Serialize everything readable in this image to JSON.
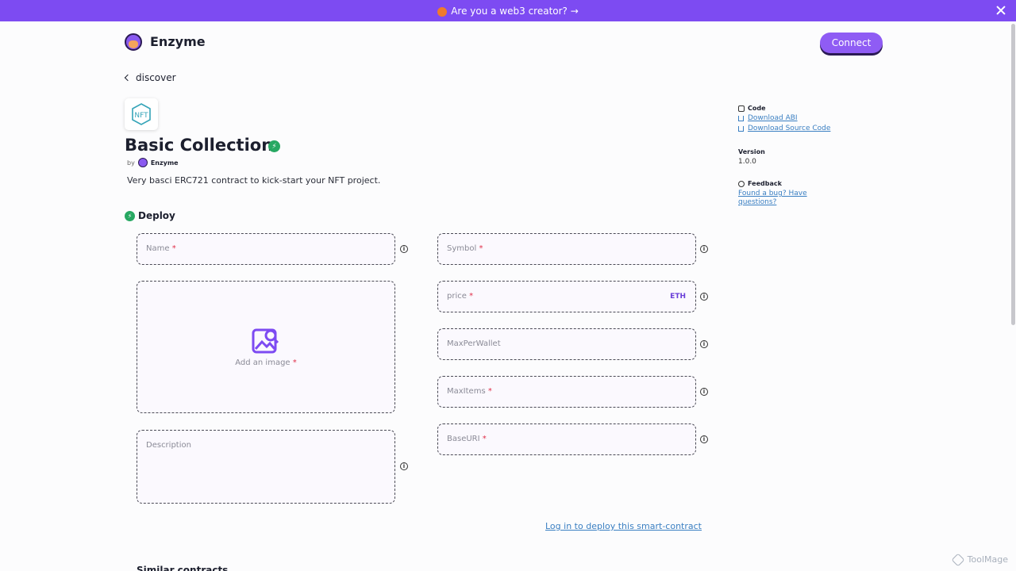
{
  "banner": {
    "text": "Are you a web3 creator? →"
  },
  "header": {
    "brand": "Enzyme",
    "connect_label": "Connect"
  },
  "nav": {
    "back_label": "discover"
  },
  "contract": {
    "title": "Basic Collection",
    "by_label": "by",
    "author": "Enzyme",
    "description": "Very basci ERC721 contract to kick-start your NFT project."
  },
  "deploy": {
    "heading": "Deploy",
    "fields": {
      "name": "Name",
      "symbol": "Symbol",
      "price": "price",
      "price_unit": "ETH",
      "max_per_wallet": "MaxPerWallet",
      "max_items": "MaxItems",
      "base_uri": "BaseURI",
      "description": "Description",
      "image": "Add an image"
    },
    "required_mark": "*",
    "login_link": "Log in to deploy this smart-contract"
  },
  "sidebar": {
    "code_heading": "Code",
    "download_abi": "Download ABI",
    "download_source": "Download Source Code",
    "version_heading": "Version",
    "version_value": "1.0.0",
    "feedback_heading": "Feedback",
    "feedback_link": "Found a bug? Have questions?"
  },
  "footer": {
    "similar_heading": "Similar contracts"
  },
  "watermark": {
    "text": "ToolMage"
  },
  "colors": {
    "accent": "#7d4bf2",
    "verified": "#27a862",
    "link": "#3a7fc2"
  }
}
